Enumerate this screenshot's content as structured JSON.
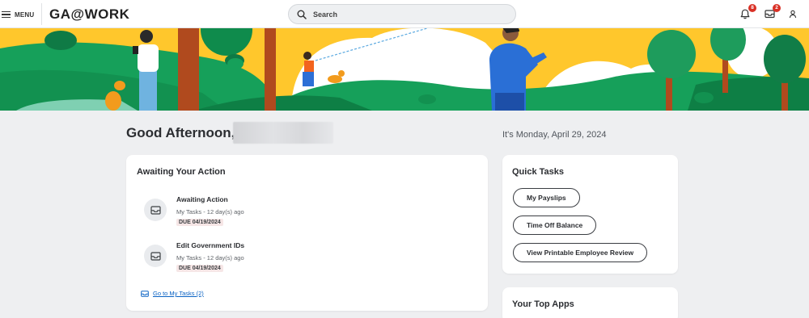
{
  "header": {
    "menu_label": "MENU",
    "logo_text": "GA@WORK",
    "search_placeholder": "Search",
    "notifications_count": "8",
    "inbox_count": "2"
  },
  "greeting": {
    "text": "Good Afternoon,",
    "date": "It's Monday, April 29, 2024"
  },
  "awaiting": {
    "title": "Awaiting Your Action",
    "tasks": [
      {
        "name": "Awaiting Action",
        "meta": "My Tasks - 12 day(s) ago",
        "due": "DUE 04/19/2024"
      },
      {
        "name": "Edit Government IDs",
        "meta": "My Tasks - 12 day(s) ago",
        "due": "DUE 04/19/2024"
      }
    ],
    "link": "Go to My Tasks (2)"
  },
  "quick_tasks": {
    "title": "Quick Tasks",
    "buttons": [
      "My Payslips",
      "Time Off Balance",
      "View Printable Employee Review"
    ]
  },
  "top_apps": {
    "title": "Your Top Apps"
  },
  "colors": {
    "accent_link": "#0b63c4",
    "badge": "#d93025",
    "banner_sky": "#ffc72c",
    "banner_grass": "#16a05a"
  }
}
